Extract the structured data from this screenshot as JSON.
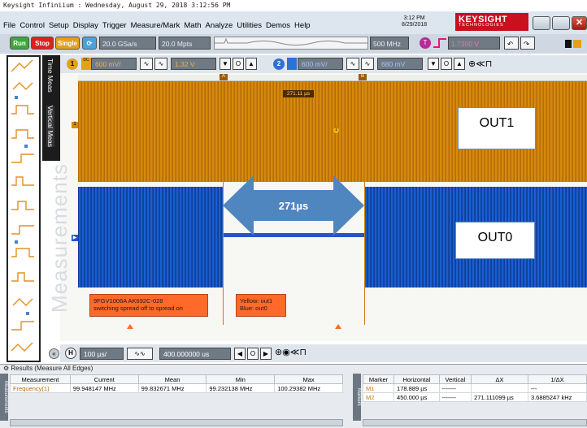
{
  "window": {
    "caption": "Keysight Infiniium : Wednesday, August 29, 2018 3:12:56 PM"
  },
  "menu": [
    "File",
    "Control",
    "Setup",
    "Display",
    "Trigger",
    "Measure/Mark",
    "Math",
    "Analyze",
    "Utilities",
    "Demos",
    "Help"
  ],
  "datetime": {
    "time": "3:12 PM",
    "date": "8/29/2018"
  },
  "brand": {
    "name": "KEYSIGHT",
    "sub": "TECHNOLOGIES"
  },
  "toolbar": {
    "run": "Run",
    "stop": "Stop",
    "single": "Single",
    "sample_rate": "20.0 GSa/s",
    "memory": "20.0 Mpts",
    "bandwidth": "500 MHz",
    "trigger_level": "1.7300 V",
    "trigger_icon": "T"
  },
  "tabs": {
    "time_meas": "Time Meas",
    "vertical_meas": "Vertical Meas",
    "measurements": "Measurements"
  },
  "channels": {
    "ch1": {
      "num": "1",
      "scale": "600 mV/",
      "offset": "1.32 V"
    },
    "ch2": {
      "num": "2",
      "scale": "600 mV/",
      "offset": "680 mV"
    }
  },
  "screen": {
    "marker_readout": "271.11 µs",
    "out1_label": "OUT1",
    "out0_label": "OUT0",
    "arrow_label": "271µs",
    "ref_label": "1",
    "marker_a": "A",
    "marker_b": "B",
    "note1": [
      "9FGV1006A AK692C-028",
      "switching spread off to spread on"
    ],
    "note2": [
      "Yellow: out1",
      "Blue:      out0"
    ],
    "ch_mark_left": "1"
  },
  "horizontal": {
    "scale": "100 µs/",
    "position": "400.000000 us"
  },
  "results": {
    "title": "Results (Measure All Edges)",
    "side_label": "Measurements",
    "markers_side": "Markers",
    "meas_headers": [
      "Measurement",
      "Current",
      "Mean",
      "Min",
      "Max"
    ],
    "meas_rows": [
      [
        "Frequency(1)",
        "99.948147 MHz",
        "99.832671 MHz",
        "99.232138 MHz",
        "100.29382 MHz"
      ]
    ],
    "marker_headers": [
      "Marker",
      "Horizontal",
      "Vertical",
      "ΔX",
      "1/ΔX"
    ],
    "marker_rows": [
      [
        "M1",
        "178.889 µs",
        "-------",
        "",
        "---"
      ],
      [
        "M2",
        "450.000 µs",
        "-------",
        "271.111099 µs",
        "3.6885247 kHz"
      ]
    ]
  },
  "colors": {
    "ch1": "#d7890e",
    "ch2": "#1a5fd0",
    "accent": "#c8101e",
    "arrow": "#4f86bf"
  }
}
